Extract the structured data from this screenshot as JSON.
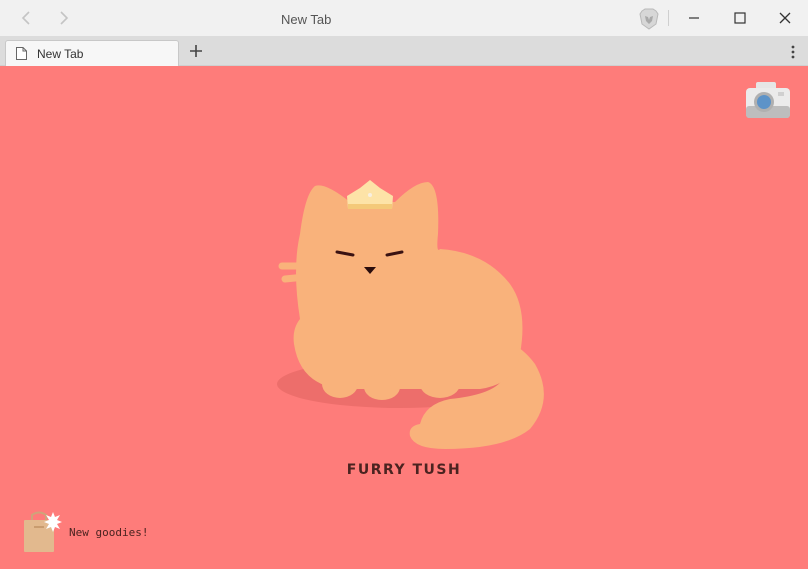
{
  "window": {
    "title": "New Tab",
    "controls": {
      "minimize_icon": "minimize-icon",
      "maximize_icon": "maximize-icon",
      "close_icon": "close-icon"
    }
  },
  "nav": {
    "back_icon": "chevron-left-icon",
    "forward_icon": "chevron-right-icon",
    "brave_icon": "brave-lion-icon"
  },
  "tabs": [
    {
      "label": "New Tab",
      "icon": "document-icon",
      "active": true
    }
  ],
  "tabbar": {
    "new_tab_icon": "plus-icon",
    "menu_icon": "kebab-menu-icon"
  },
  "page": {
    "background": "#fe7c7a",
    "camera_icon": "camera-icon",
    "illustration": "orange-cat-with-crown",
    "caption": "FURRY TUSH",
    "goodies": {
      "icon": "shopping-bag-icon",
      "label": "New goodies!"
    }
  }
}
